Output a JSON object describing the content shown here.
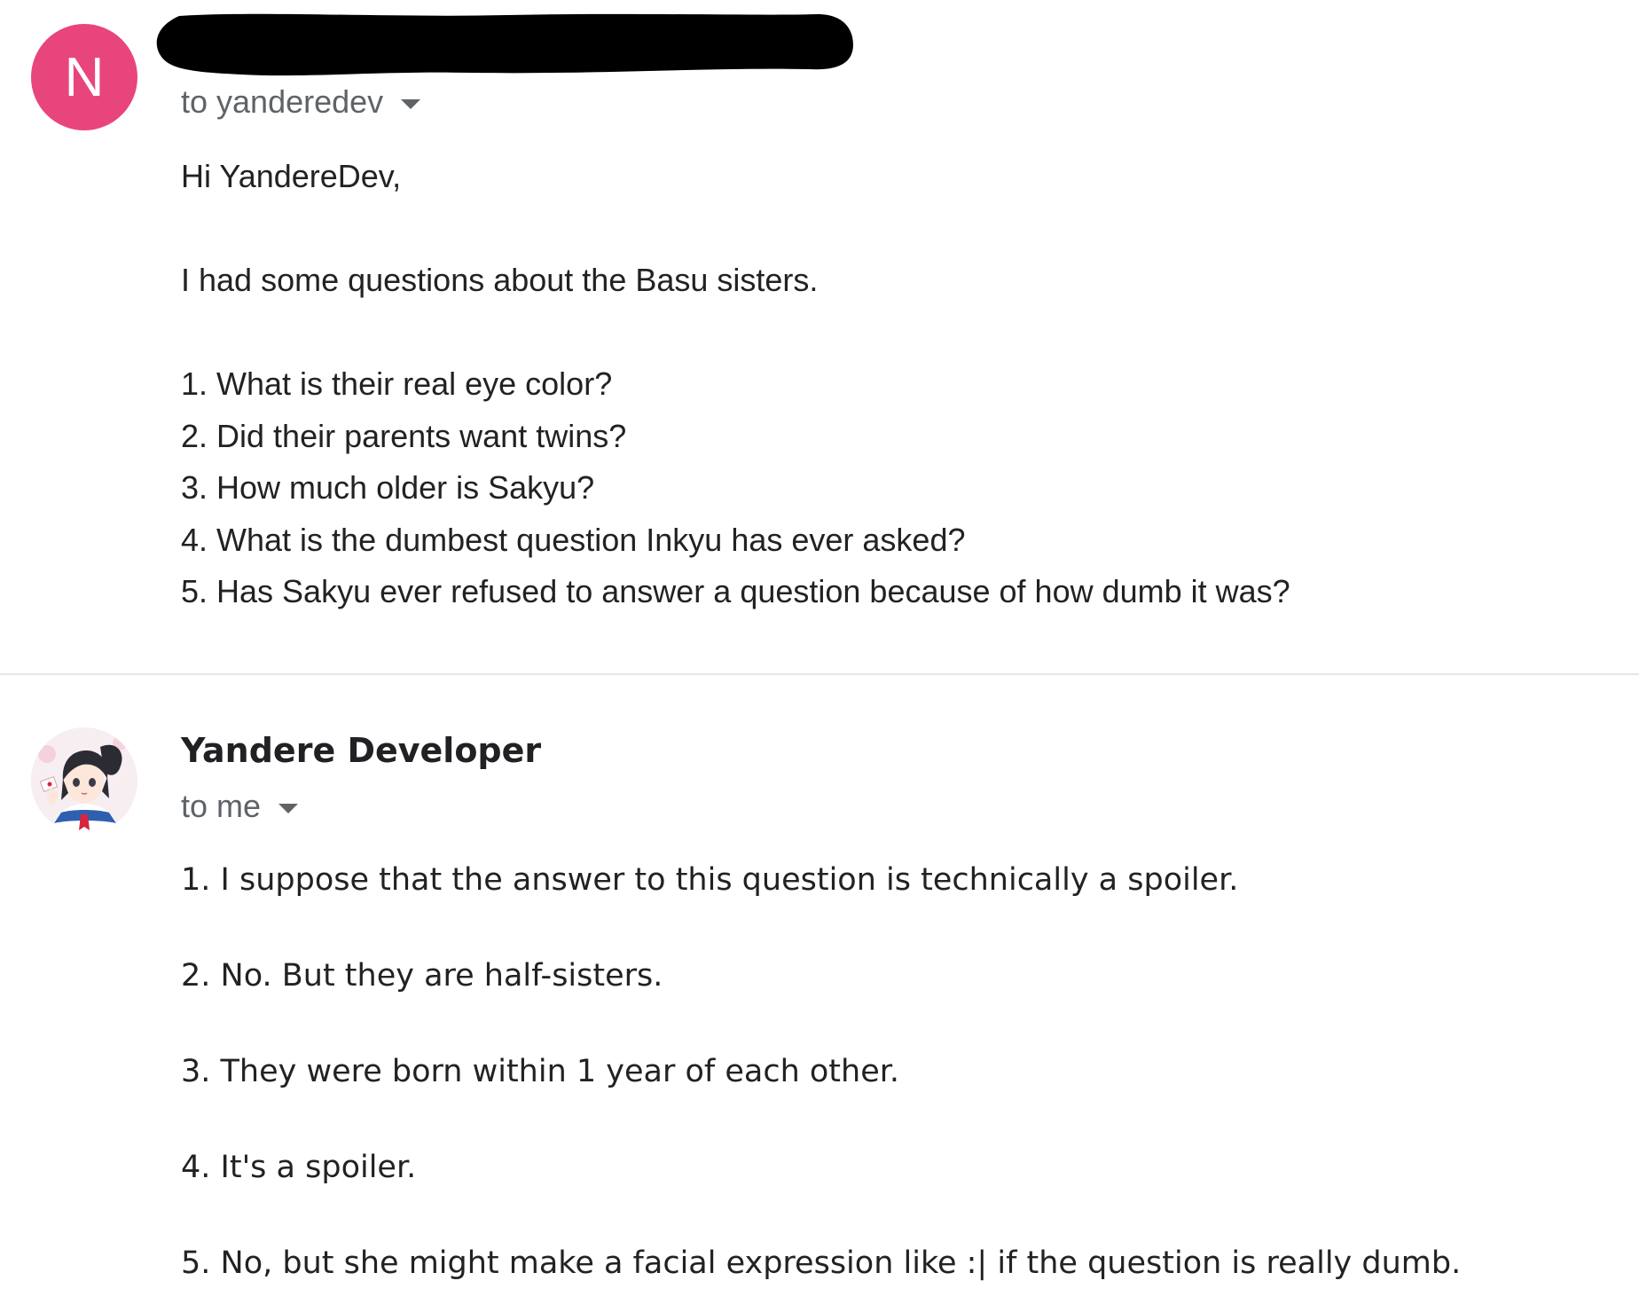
{
  "message1": {
    "avatar_letter": "N",
    "avatar_color": "#e8457d",
    "sender_redacted": true,
    "recipient_label": "to yanderedev",
    "greeting": "Hi YandereDev,",
    "intro": "I had some questions about the Basu sisters.",
    "questions": [
      "1. What is their real eye color?",
      "2. Did their parents want twins?",
      "3. How much older is Sakyu?",
      "4. What is the dumbest question Inkyu has ever asked?",
      "5. Has Sakyu ever refused to answer a question because of how dumb it was?"
    ]
  },
  "message2": {
    "sender_name": "Yandere Developer",
    "recipient_label": "to me",
    "answers": [
      "1. I suppose that the answer to this question is technically a spoiler.",
      "2. No. But they are half-sisters.",
      "3. They were born within 1 year of each other.",
      "4. It's a spoiler.",
      "5. No, but she might make a facial expression like :| if the question is really dumb."
    ]
  }
}
